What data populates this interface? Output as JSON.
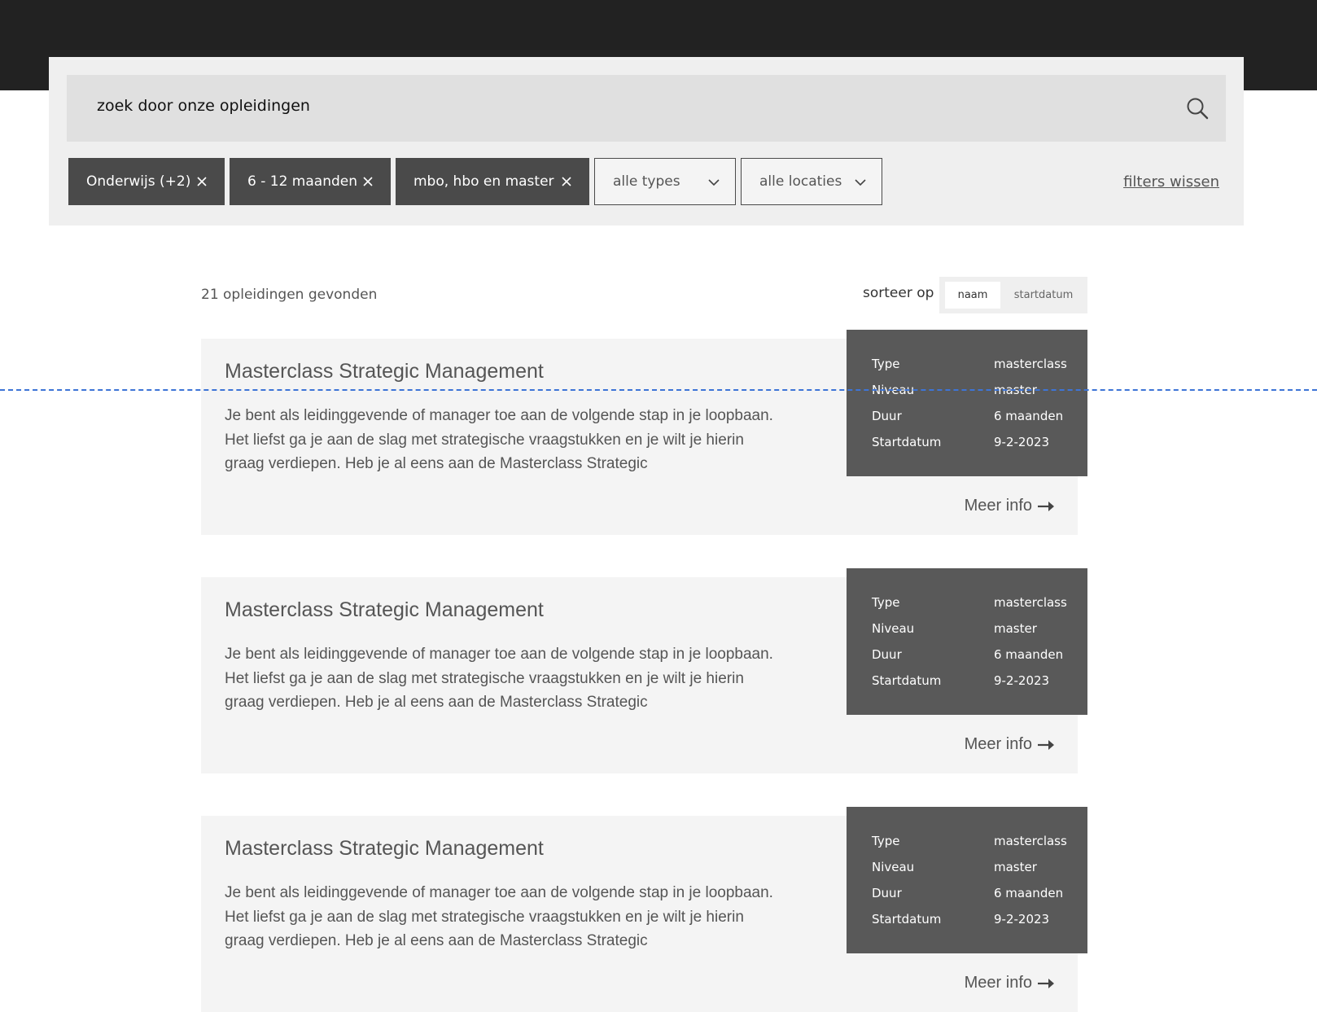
{
  "search": {
    "placeholder": "zoek door onze opleidingen"
  },
  "filters": {
    "chips": [
      {
        "label": "Onderwijs (+2)"
      },
      {
        "label": "6 - 12 maanden"
      },
      {
        "label": "mbo, hbo en master"
      }
    ],
    "dropdowns": [
      {
        "label": "alle types"
      },
      {
        "label": "alle locaties"
      }
    ],
    "clear_label": "filters wissen"
  },
  "results": {
    "count_label": "21 opleidingen gevonden",
    "sort_label": "sorteer op",
    "sort_options": [
      {
        "label": "naam",
        "active": true
      },
      {
        "label": "startdatum",
        "active": false
      }
    ]
  },
  "courses": [
    {
      "title": "Masterclass Strategic Management",
      "description": "Je bent als leidinggevende of manager toe aan de volgende stap in je loopbaan. Het liefst ga je aan de slag met strategische vraagstukken en je wilt je hierin graag verdiepen. Heb je al eens aan de Masterclass Strategic",
      "more_label": "Meer info",
      "meta": [
        {
          "key": "Type",
          "value": "masterclass"
        },
        {
          "key": "Niveau",
          "value": "master"
        },
        {
          "key": "Duur",
          "value": "6 maanden"
        },
        {
          "key": "Startdatum",
          "value": "9-2-2023"
        }
      ]
    },
    {
      "title": "Masterclass Strategic Management",
      "description": "Je bent als leidinggevende of manager toe aan de volgende stap in je loopbaan. Het liefst ga je aan de slag met strategische vraagstukken en je wilt je hierin graag verdiepen. Heb je al eens aan de Masterclass Strategic",
      "more_label": "Meer info",
      "meta": [
        {
          "key": "Type",
          "value": "masterclass"
        },
        {
          "key": "Niveau",
          "value": "master"
        },
        {
          "key": "Duur",
          "value": "6 maanden"
        },
        {
          "key": "Startdatum",
          "value": "9-2-2023"
        }
      ]
    },
    {
      "title": "Masterclass Strategic Management",
      "description": "Je bent als leidinggevende of manager toe aan de volgende stap in je loopbaan. Het liefst ga je aan de slag met strategische vraagstukken en je wilt je hierin graag verdiepen. Heb je al eens aan de Masterclass Strategic",
      "more_label": "Meer info",
      "meta": [
        {
          "key": "Type",
          "value": "masterclass"
        },
        {
          "key": "Niveau",
          "value": "master"
        },
        {
          "key": "Duur",
          "value": "6 maanden"
        },
        {
          "key": "Startdatum",
          "value": "9-2-2023"
        }
      ]
    }
  ]
}
